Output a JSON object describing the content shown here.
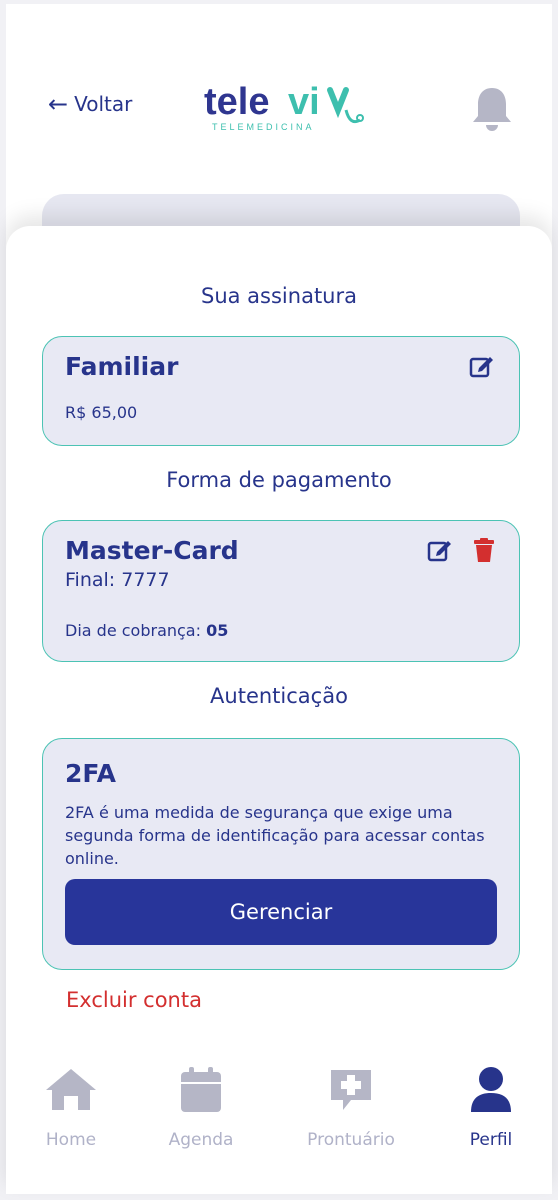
{
  "header": {
    "back_label": "Voltar",
    "logo_text": "televiv",
    "logo_subtitle": "TELEMEDICINA"
  },
  "subscription": {
    "section_title": "Sua assinatura",
    "plan_name": "Familiar",
    "price": "R$ 65,00"
  },
  "payment": {
    "section_title": "Forma de pagamento",
    "card_brand": "Master-Card",
    "card_final": "Final: 7777",
    "billing_day_label": "Dia de cobrança: ",
    "billing_day_value": "05"
  },
  "auth": {
    "section_title": "Autenticação",
    "title": "2FA",
    "description": "2FA é uma medida de segurança que exige uma segunda forma de identificação para acessar contas online.",
    "button_label": "Gerenciar"
  },
  "delete_account_label": "Excluir conta",
  "nav": {
    "items": [
      {
        "label": "Home",
        "icon": "home-icon"
      },
      {
        "label": "Agenda",
        "icon": "calendar-icon"
      },
      {
        "label": "Prontuário",
        "icon": "medical-record-icon"
      },
      {
        "label": "Perfil",
        "icon": "user-icon"
      }
    ]
  },
  "colors": {
    "primary": "#27348b",
    "button": "#28359a",
    "card_bg": "#e8e9f4",
    "card_border": "#4cc3b4",
    "danger": "#d32f2f",
    "nav_inactive": "#b0b2c8",
    "logo_accent": "#3dbfae"
  }
}
